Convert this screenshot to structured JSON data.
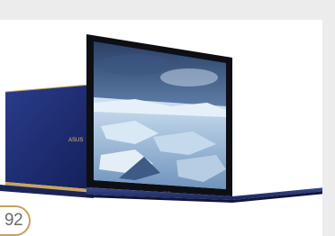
{
  "page": {
    "number": "92"
  },
  "photo": {
    "subject": "laptop-product-photo",
    "brand_mark": "ASUS",
    "colors": {
      "chassis": "#1b2a6b",
      "trim": "#c8a45c",
      "strip": "#ececec",
      "badge_ring": "#c9a061"
    }
  }
}
